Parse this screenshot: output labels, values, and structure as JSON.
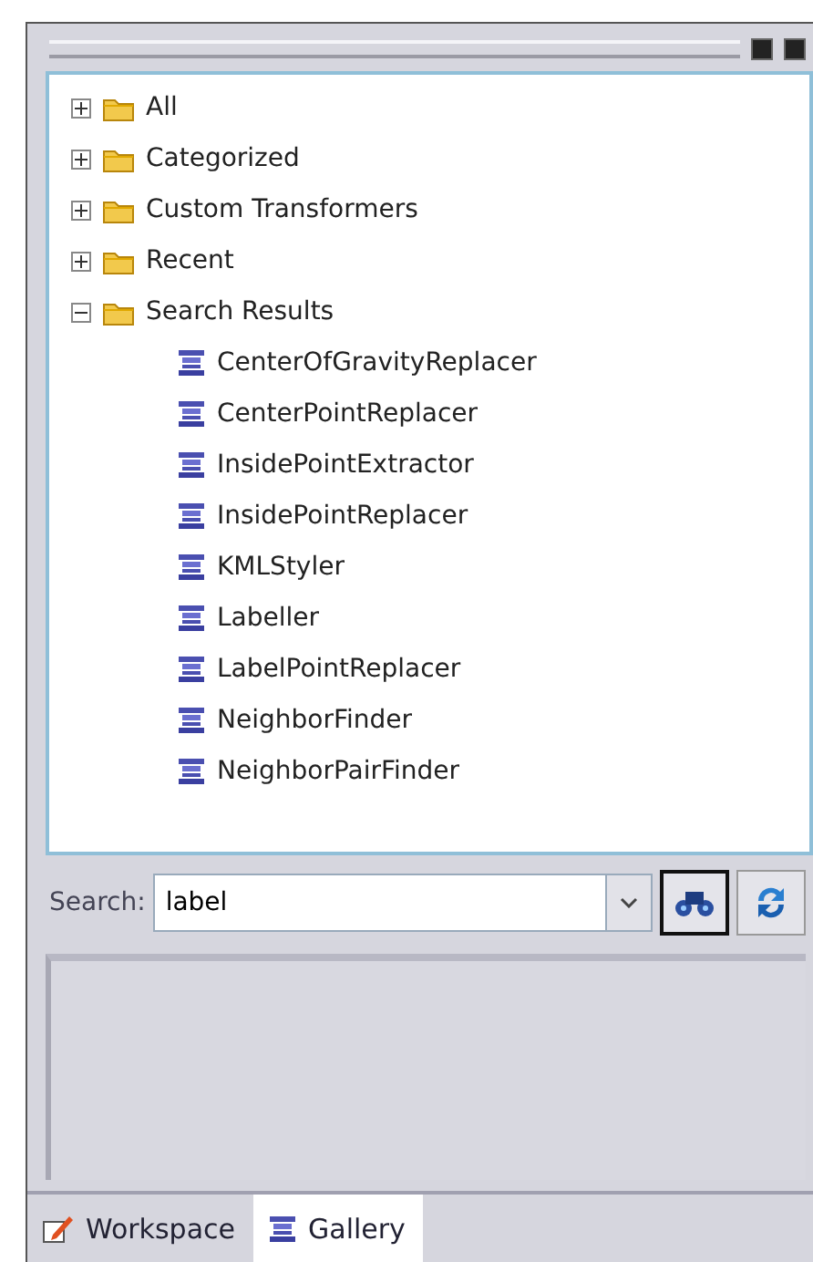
{
  "tree": [
    {
      "label": "All",
      "kind": "folder",
      "expanded": false
    },
    {
      "label": "Categorized",
      "kind": "folder",
      "expanded": false
    },
    {
      "label": "Custom Transformers",
      "kind": "folder",
      "expanded": false
    },
    {
      "label": "Recent",
      "kind": "folder",
      "expanded": false
    },
    {
      "label": "Search Results",
      "kind": "folder",
      "expanded": true,
      "children": [
        {
          "label": "CenterOfGravityReplacer",
          "kind": "transformer"
        },
        {
          "label": "CenterPointReplacer",
          "kind": "transformer"
        },
        {
          "label": "InsidePointExtractor",
          "kind": "transformer"
        },
        {
          "label": "InsidePointReplacer",
          "kind": "transformer"
        },
        {
          "label": "KMLStyler",
          "kind": "transformer"
        },
        {
          "label": "Labeller",
          "kind": "transformer"
        },
        {
          "label": "LabelPointReplacer",
          "kind": "transformer"
        },
        {
          "label": "NeighborFinder",
          "kind": "transformer"
        },
        {
          "label": "NeighborPairFinder",
          "kind": "transformer"
        }
      ]
    }
  ],
  "search": {
    "label": "Search:",
    "value": "label"
  },
  "tabs": [
    {
      "label": "Workspace",
      "kind": "workspace",
      "selected": false
    },
    {
      "label": "Gallery",
      "kind": "gallery",
      "selected": true
    }
  ]
}
